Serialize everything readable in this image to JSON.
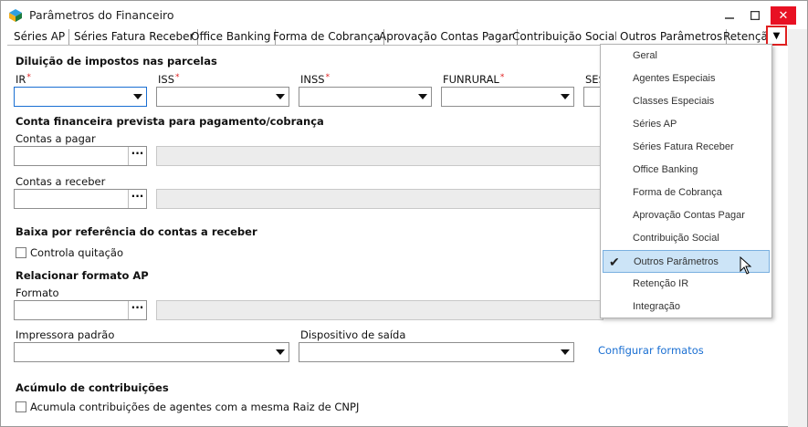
{
  "window": {
    "title": "Parâmetros do Financeiro",
    "min_label": "—",
    "max_label": "☐",
    "close_label": "✕"
  },
  "tabs": [
    "Séries AP",
    "Séries Fatura Receber",
    "Office Banking",
    "Forma de Cobrança",
    "Aprovação Contas Pagar",
    "Contribuição Social",
    "Outros Parâmetros",
    "Retençã"
  ],
  "tab_overflow_label": "▼",
  "form": {
    "diluicao_title": "Diluição de impostos nas parcelas",
    "ir_label": "IR",
    "iss_label": "ISS",
    "inss_label": "INSS",
    "funrural_label": "FUNRURAL",
    "sest_label": "SES",
    "required_mark": "*",
    "conta_title": "Conta financeira prevista para pagamento/cobrança",
    "contas_pagar_label": "Contas a pagar",
    "contas_receber_label": "Contas a receber",
    "lookup_button": "···",
    "baixa_title": "Baixa por referência do contas a receber",
    "controla_quitacao_label": "Controla quitação",
    "relacionar_title": "Relacionar formato AP",
    "formato_label": "Formato",
    "impressora_label": "Impressora padrão",
    "dispositivo_label": "Dispositivo de saída",
    "configurar_link": "Configurar formatos",
    "acumulo_title": "Acúmulo de contribuições",
    "acumula_label": "Acumula contribuições de agentes com a mesma Raiz de CNPJ"
  },
  "menu": {
    "items": [
      "Geral",
      "Agentes Especiais",
      "Classes Especiais",
      "Séries AP",
      "Séries Fatura Receber",
      "Office Banking",
      "Forma de Cobrança",
      "Aprovação Contas Pagar",
      "Contribuição Social",
      "Outros Parâmetros",
      "Retenção IR",
      "Integração"
    ],
    "selected": "Outros Parâmetros",
    "check_glyph": "✔"
  },
  "colors": {
    "accent": "#1a6fd2",
    "close_red": "#e81123",
    "menu_highlight": "#cce4f7",
    "overflow_border": "#e02020"
  }
}
